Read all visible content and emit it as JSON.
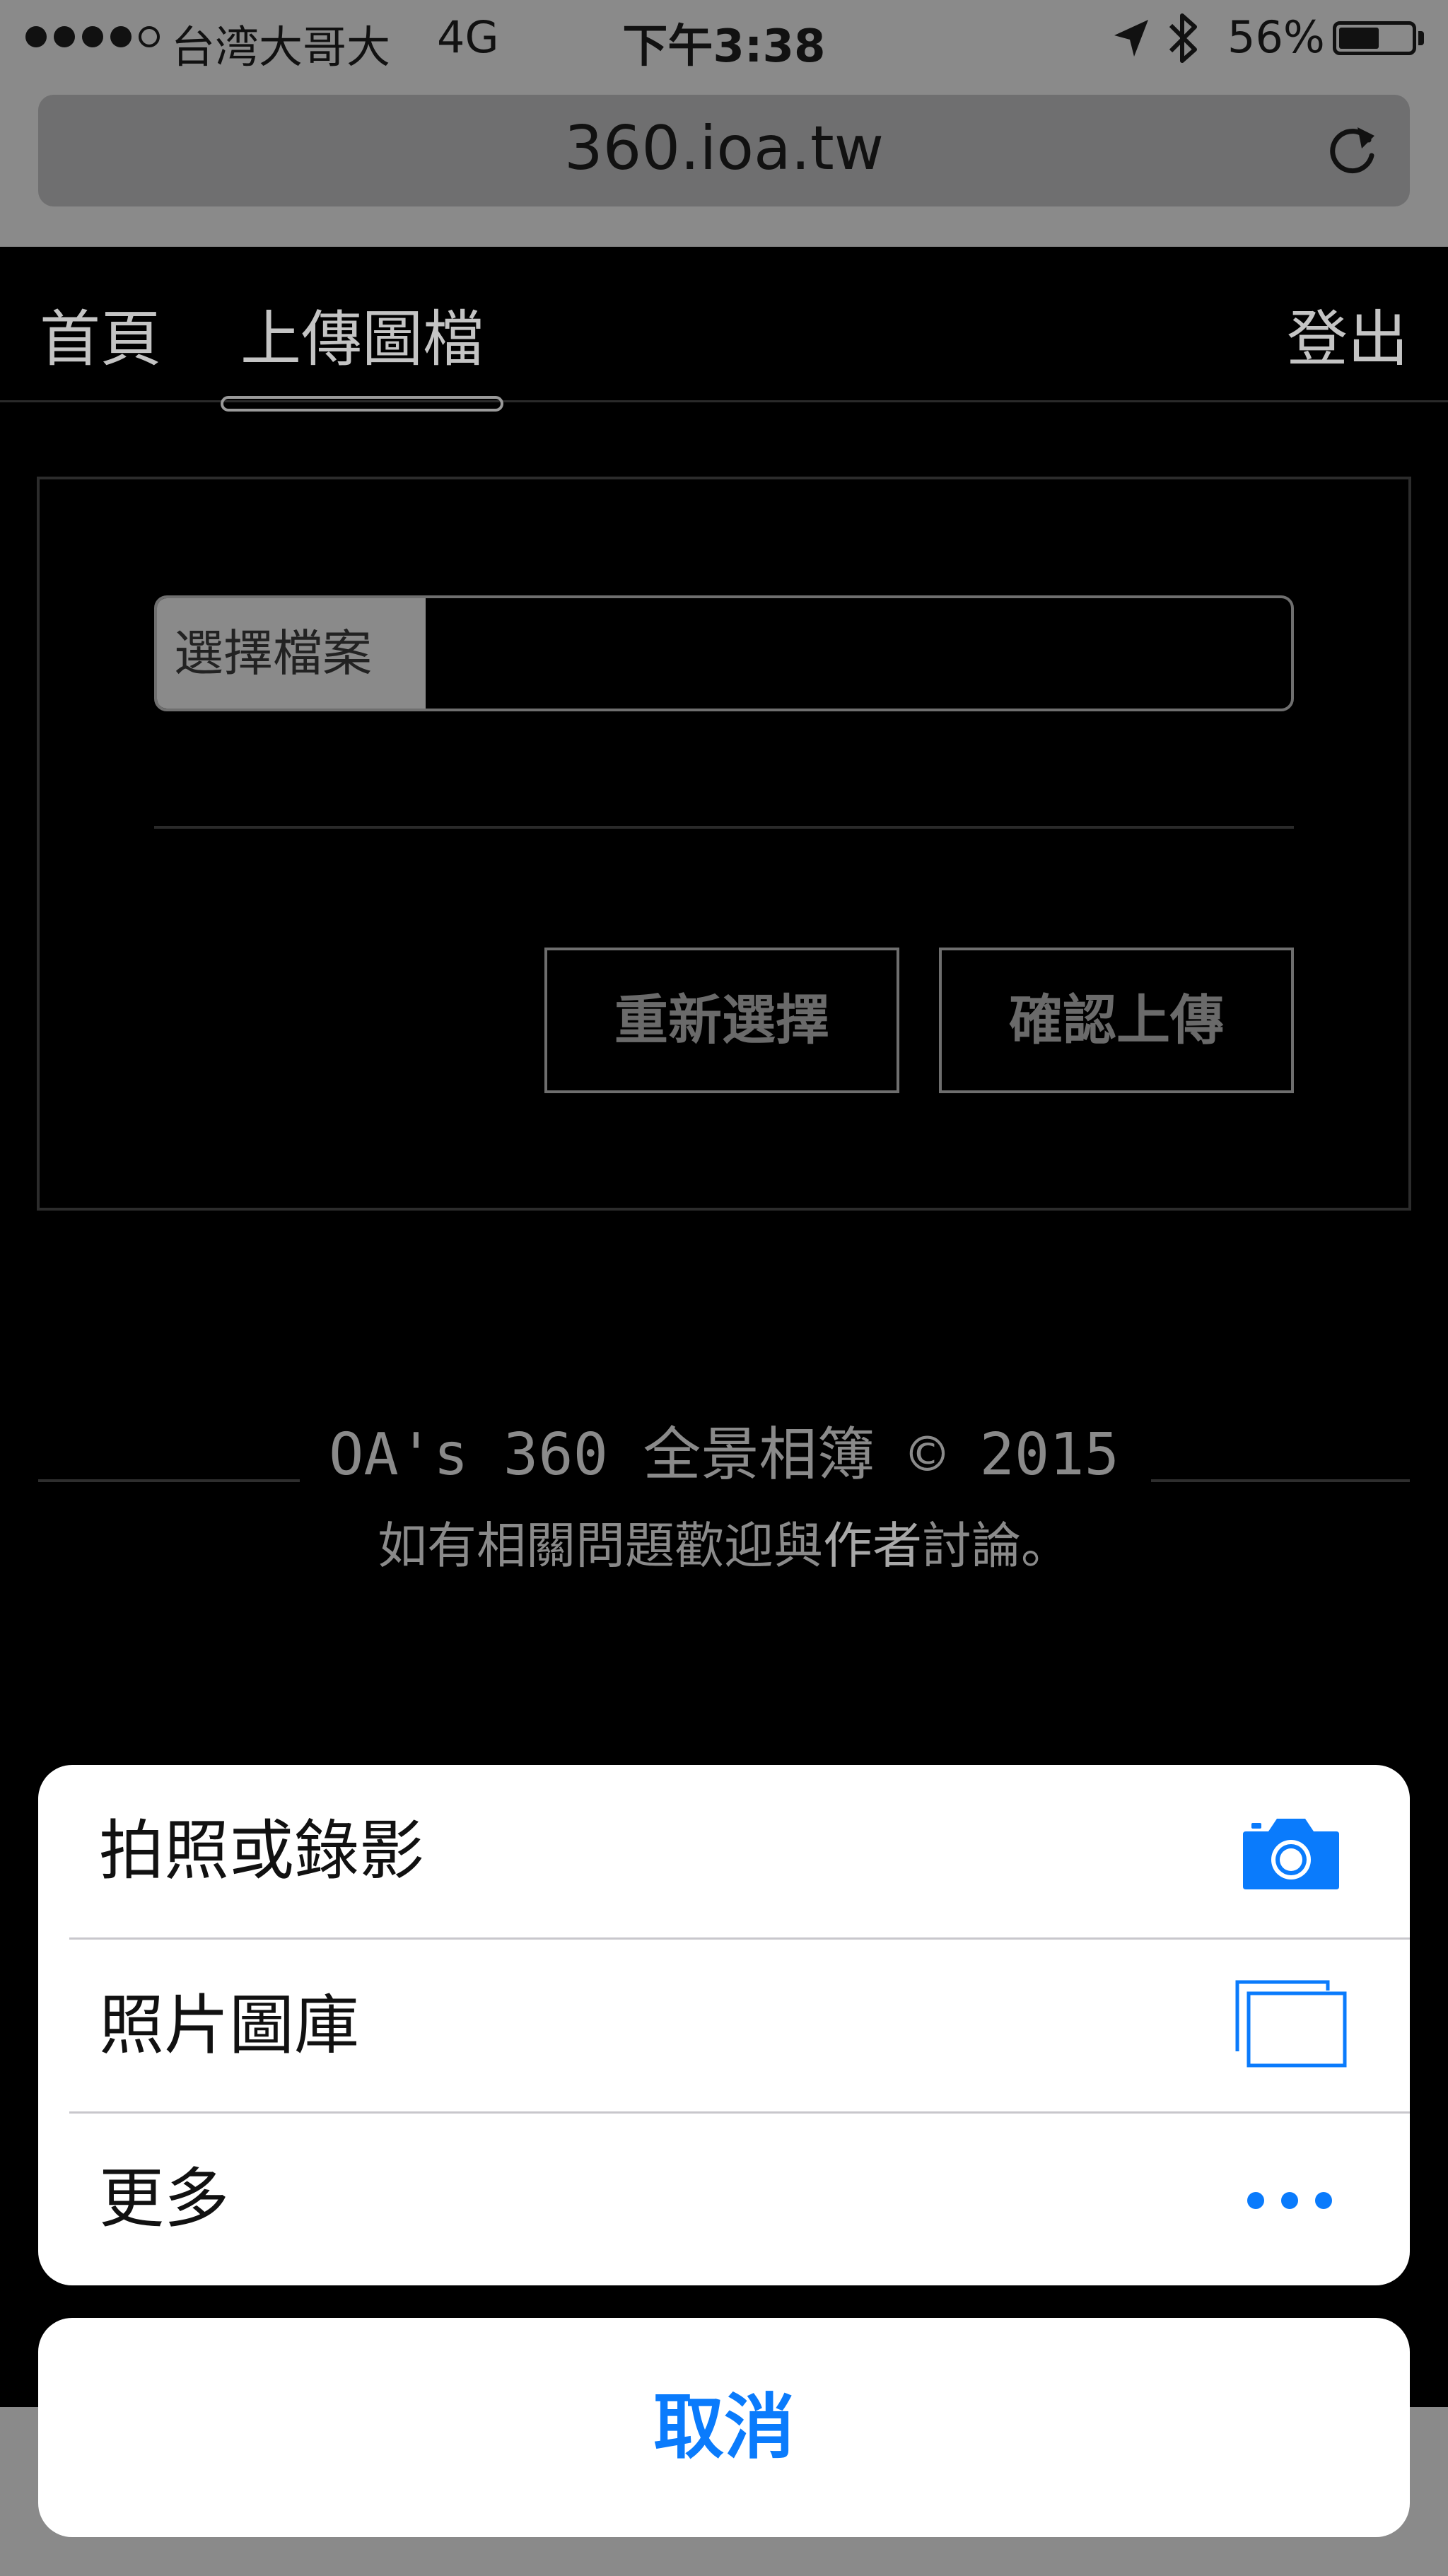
{
  "status_bar": {
    "carrier": "台湾大哥大",
    "network": "4G",
    "time": "下午3:38",
    "battery_percent": "56%",
    "battery_level": 0.56,
    "signal_bars_filled": 4,
    "signal_bars_total": 5,
    "icons": [
      "location-arrow-icon",
      "bluetooth-icon",
      "battery-icon"
    ]
  },
  "browser": {
    "url": "360.ioa.tw",
    "reload_icon": "reload-icon"
  },
  "nav": {
    "items": [
      {
        "label": "首頁"
      },
      {
        "label": "上傳圖檔"
      }
    ],
    "logout": "登出"
  },
  "upload": {
    "choose_file_label": "選擇檔案",
    "reselect_label": "重新選擇",
    "confirm_label": "確認上傳"
  },
  "footer": {
    "title": "OA's 360 全景相簿 © 2015",
    "sub_before": "如有相關問題歡迎與",
    "sub_link": "作者",
    "sub_after": "討論。"
  },
  "action_sheet": {
    "items": [
      {
        "label": "拍照或錄影",
        "icon": "camera-icon"
      },
      {
        "label": "照片圖庫",
        "icon": "photo-library-icon"
      },
      {
        "label": "更多",
        "icon": "more-dots-icon"
      }
    ],
    "cancel": "取消",
    "accent_color": "#0a7bfc"
  }
}
